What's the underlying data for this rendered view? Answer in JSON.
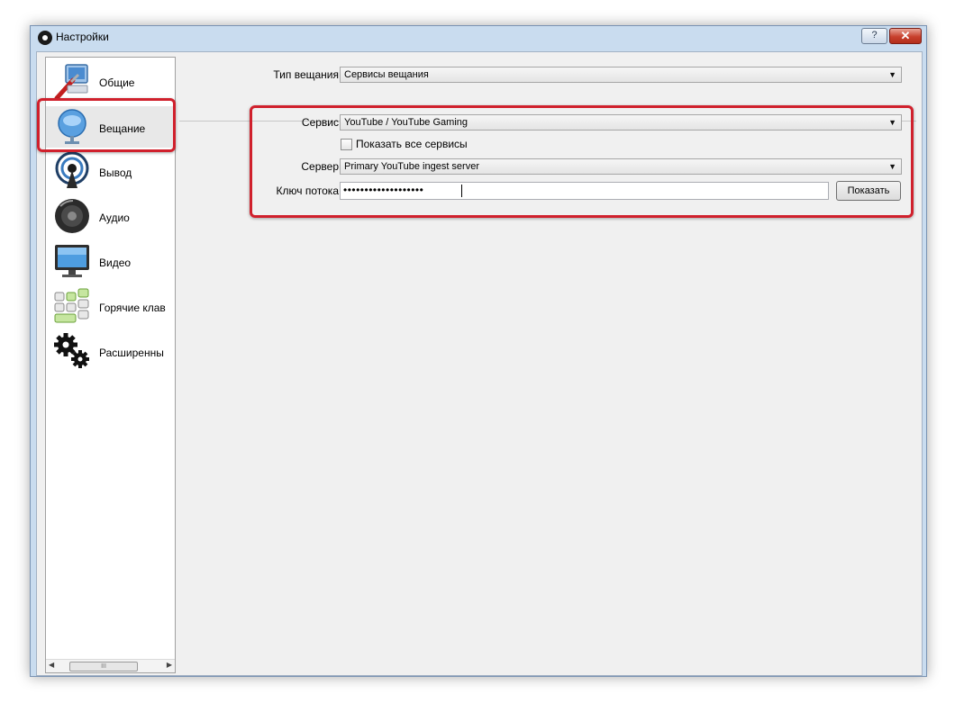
{
  "window": {
    "title": "Настройки",
    "help_label": "?",
    "close_label": "✕"
  },
  "sidebar": {
    "items": [
      {
        "label": "Общие",
        "icon": "general-settings-icon"
      },
      {
        "label": "Вещание",
        "icon": "broadcast-globe-icon",
        "selected": true
      },
      {
        "label": "Вывод",
        "icon": "output-signal-icon"
      },
      {
        "label": "Аудио",
        "icon": "speaker-icon"
      },
      {
        "label": "Видео",
        "icon": "monitor-icon"
      },
      {
        "label": "Горячие клав",
        "icon": "hotkeys-icon"
      },
      {
        "label": "Расширенны",
        "icon": "gears-icon"
      }
    ],
    "scroll_left": "◀",
    "scroll_right": "▶",
    "scroll_grip": "III"
  },
  "form": {
    "stream_type_label": "Тип вещания",
    "stream_type_value": "Сервисы вещания",
    "service_label": "Сервис",
    "service_value": "YouTube / YouTube Gaming",
    "show_all_label": "Показать все сервисы",
    "show_all_checked": false,
    "server_label": "Сервер",
    "server_value": "Primary YouTube ingest server",
    "key_label": "Ключ потока",
    "key_value": "•••••••••••••••••••",
    "show_button": "Показать",
    "dropdown_arrow": "▼"
  },
  "colors": {
    "highlight": "#d0202c",
    "titlebar": "#c9dcef",
    "close_button": "#c8402d"
  }
}
